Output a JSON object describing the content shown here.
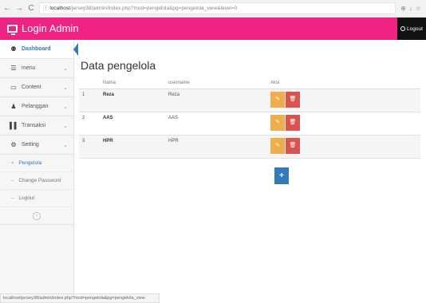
{
  "browser": {
    "url_host": "localhost",
    "url_path": "/jersey38/admin/index.php?mod=pengelola&pg=pengelola_view&level=0",
    "back": "←",
    "forward": "→",
    "reload": "C",
    "info": "ⓘ",
    "icons": [
      "⊕",
      "↓",
      "☆"
    ]
  },
  "header": {
    "title": "Login Admin",
    "logout_label": "Logout"
  },
  "sidebar": {
    "items": [
      {
        "label": "Dashboard",
        "icon": "dashboard-icon"
      },
      {
        "label": "menu",
        "icon": "list-icon"
      },
      {
        "label": "Content",
        "icon": "monitor-icon"
      },
      {
        "label": "Pelanggan",
        "icon": "user-icon"
      },
      {
        "label": "Transaksi",
        "icon": "barcode-icon"
      },
      {
        "label": "Setting",
        "icon": "gear-icon"
      }
    ],
    "sub_items": [
      "Pengelola",
      "Change Password",
      "Logout"
    ]
  },
  "main": {
    "title": "Data pengelola",
    "columns": [
      "",
      "Nama",
      "username",
      "Aksi"
    ],
    "rows": [
      {
        "no": "1",
        "nama": "Reza",
        "username": "Reza"
      },
      {
        "no": "2",
        "nama": "AAS",
        "username": "AAS"
      },
      {
        "no": "3",
        "nama": "HPR",
        "username": "HPR"
      }
    ],
    "add_label": "+"
  },
  "status_bar": "localhost/jersey38/admin/index.php?mod=pengelola&pg=pengelola_view",
  "colors": {
    "header": "#f02385",
    "edit": "#f0ad4e",
    "delete": "#d9534f",
    "add": "#337ab7"
  }
}
